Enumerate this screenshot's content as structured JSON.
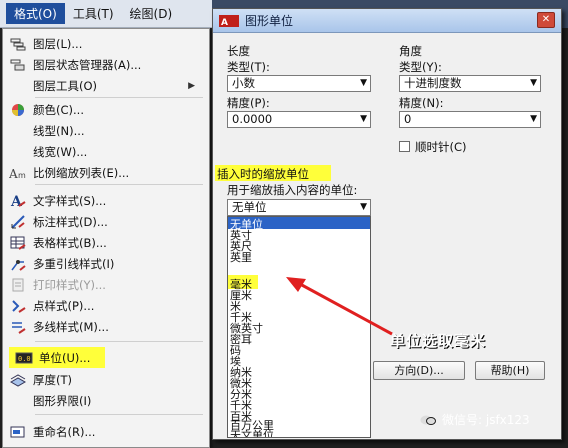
{
  "menubar": {
    "items": [
      "格式(O)",
      "工具(T)",
      "绘图(D)"
    ]
  },
  "format_menu": {
    "items": [
      {
        "label": "图层(L)...",
        "icon": "layer-icon"
      },
      {
        "label": "图层状态管理器(A)...",
        "icon": "layer-state-icon"
      },
      {
        "label": "图层工具(O)",
        "icon": "",
        "submenu": "▶"
      },
      {
        "label": "颜色(C)...",
        "icon": "color-wheel-icon"
      },
      {
        "label": "线型(N)...",
        "icon": ""
      },
      {
        "label": "线宽(W)...",
        "icon": ""
      },
      {
        "label": "比例缩放列表(E)...",
        "icon": "scale-list-icon"
      },
      {
        "label": "文字样式(S)...",
        "icon": "text-style-icon"
      },
      {
        "label": "标注样式(D)...",
        "icon": "dimension-style-icon"
      },
      {
        "label": "表格样式(B)...",
        "icon": "table-style-icon"
      },
      {
        "label": "多重引线样式(I)",
        "icon": "multileader-style-icon"
      },
      {
        "label": "打印样式(Y)...",
        "icon": "plot-style-icon"
      },
      {
        "label": "点样式(P)...",
        "icon": "point-style-icon"
      },
      {
        "label": "多线样式(M)...",
        "icon": "multiline-style-icon"
      },
      {
        "label": "单位(U)...",
        "icon": "units-icon"
      },
      {
        "label": "厚度(T)",
        "icon": "thickness-icon"
      },
      {
        "label": "图形界限(I)",
        "icon": ""
      },
      {
        "label": "重命名(R)...",
        "icon": "rename-icon"
      }
    ]
  },
  "dialog": {
    "title": "图形单位",
    "length": {
      "heading": "长度",
      "type_label": "类型(T):",
      "type_value": "小数",
      "precision_label": "精度(P):",
      "precision_value": "0.0000"
    },
    "angle": {
      "heading": "角度",
      "type_label": "类型(Y):",
      "type_value": "十进制度数",
      "precision_label": "精度(N):",
      "precision_value": "0",
      "clockwise_label": "顺时针(C)"
    },
    "insert_scale": {
      "heading": "插入时的缩放单位",
      "desc": "用于缩放插入内容的单位:",
      "value": "无单位"
    },
    "unit_options": [
      "无单位",
      "英寸",
      "英尺",
      "英里",
      "毫米",
      "厘米",
      "米",
      "千米",
      "微英寸",
      "密耳",
      "码",
      "埃",
      "纳米",
      "微米",
      "分米",
      "千米",
      "百米",
      "百万公里",
      "天文单位"
    ],
    "buttons": {
      "direction": "方向(D)...",
      "help": "帮助(H)"
    }
  },
  "annotation": {
    "callout": "单位选取毫米",
    "arrow_color": "#e02020"
  },
  "watermark": "微信号: jsfx123",
  "colors": {
    "highlight": "#ffff3a",
    "selection": "#2b63c6",
    "menu_active": "#1f4e9c"
  }
}
